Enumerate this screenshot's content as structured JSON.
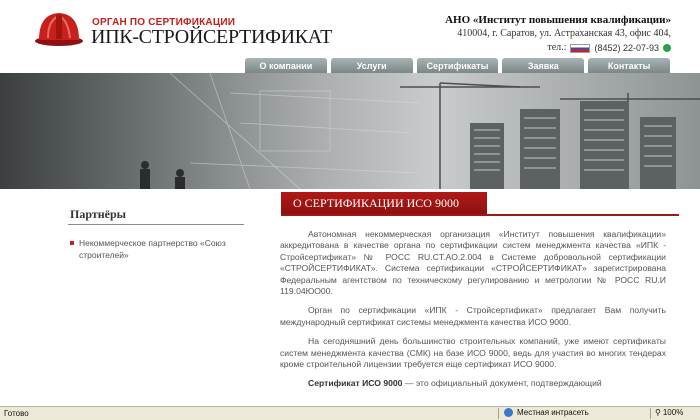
{
  "header": {
    "org_label": "ОРГАН ПО СЕРТИФИКАЦИИ",
    "org_name": "ИПК-СТРОЙСЕРТИФИКАТ",
    "institute": "АНО «Институт повышения квалификации»",
    "address": "410004, г. Саратов, ул. Астраханская 43, офис 404,",
    "phone_prefix": "тел.:",
    "phone": "(8452) 22-07-93"
  },
  "nav": {
    "items": [
      "О компании",
      "Услуги",
      "Сертификаты",
      "Заявка",
      "Контакты"
    ]
  },
  "sidebar": {
    "title": "Партнёры",
    "items": [
      "Некоммерческое партнерство «Союз строителей»"
    ]
  },
  "main": {
    "title": "О СЕРТИФИКАЦИИ ИСО 9000",
    "paragraphs": [
      "Автономная некоммерческая организация «Институт повышения квалификации» аккредитована в качестве органа по сертификации систем менеджмента качества «ИПК - Стройсертификат» № РОСС RU.CT.AO.2.004 в Системе добровольной сертификации «СТРОЙСЕРТИФИКАТ». Система сертификации «СТРОЙСЕРТИФИКАТ» зарегистрирована Федеральным агентством по техническому регулированию и метрологии № РОСС RU.И 119.04ЮО00.",
      "Орган по сертификации «ИПК - Стройсертификат» предлагает Вам получить международный сертификат системы менеджмента качества ИСО 9000.",
      "На сегодняшний день большинство строительных компаний, уже имеют сертификаты систем менеджмента качества (СМК) на базе ИСО 9000, ведь для участия во многих тендерах кроме строительной лицензии требуется еще сертификат ИСО 9000."
    ],
    "last_bold": "Сертификат ИСО 9000",
    "last_rest": " — это официальный документ, подтверждающий"
  },
  "statusbar": {
    "status": "Готово",
    "zone": "Местная интрасеть",
    "zoom": "100%"
  },
  "colors": {
    "accent": "#b01a18",
    "nav": "#8c9797"
  }
}
